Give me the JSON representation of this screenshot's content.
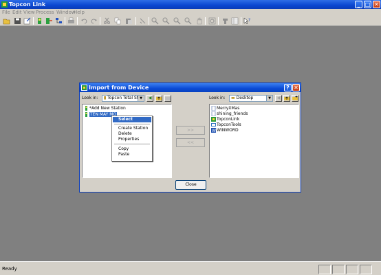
{
  "app": {
    "title": "Topcon Link",
    "controls": {
      "minimize": "_",
      "maximize": "□",
      "close": "✕"
    }
  },
  "menu": [
    "File",
    "Edit",
    "View",
    "Process",
    "Window",
    "Help"
  ],
  "toolbar_icons": [
    "open-folder-icon",
    "save-icon",
    "export-icon",
    "import-device-icon",
    "import-file-icon",
    "network-icon",
    "print-icon",
    "undo-icon",
    "redo-icon",
    "cut-icon",
    "copy-icon",
    "paste-icon",
    "process-icon",
    "zoom-in-icon",
    "zoom-out-icon",
    "zoom-window-icon",
    "zoom-extents-icon",
    "pan-icon",
    "refresh-icon",
    "settings-icon",
    "table-icon",
    "help-pointer-icon"
  ],
  "status": {
    "text": "Ready"
  },
  "dialog": {
    "title": "Import from Device",
    "help_button": "?",
    "close_button": "✕",
    "left": {
      "look_in_label": "Look in:",
      "look_in_value": "Topcon Total St",
      "items": [
        {
          "label": "*Add New Station",
          "icon": "station-icon"
        },
        {
          "label": "TEN MAY MO",
          "icon": "station-icon",
          "selected": true
        }
      ]
    },
    "right": {
      "look_in_label": "Look in:",
      "look_in_value": "Desktop",
      "items": [
        {
          "label": "MerryXMas",
          "icon": "file-icon"
        },
        {
          "label": "shining_friends",
          "icon": "file-icon"
        },
        {
          "label": "TopconLink",
          "icon": "shortcut-icon"
        },
        {
          "label": "TopconTools",
          "icon": "folder-icon"
        },
        {
          "label": "WINWORD",
          "icon": "word-icon"
        }
      ]
    },
    "transfer_right": ">>",
    "transfer_left": "<<",
    "close_label": "Close"
  },
  "context_menu": {
    "items": [
      "Select",
      "Create Station",
      "Delete",
      "Properties",
      "Copy",
      "Paste"
    ]
  },
  "colors": {
    "title_blue": "#0a46d0",
    "selection": "#316ac5",
    "workspace": "#808080"
  }
}
